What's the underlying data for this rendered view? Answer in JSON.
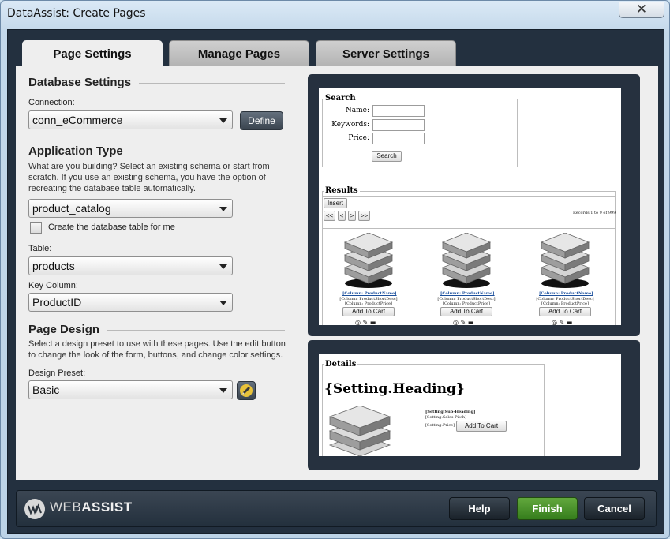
{
  "window": {
    "title": "DataAssist: Create Pages",
    "close_glyph": "✕"
  },
  "tabs": [
    {
      "label": "Page Settings",
      "active": true
    },
    {
      "label": "Manage Pages",
      "active": false
    },
    {
      "label": "Server Settings",
      "active": false
    }
  ],
  "database_settings": {
    "heading": "Database Settings",
    "connection_label": "Connection:",
    "connection_value": "conn_eCommerce",
    "define_label": "Define"
  },
  "application_type": {
    "heading": "Application Type",
    "description_1": "What are you building? Select an existing schema or start from",
    "description_2": "scratch. If you use an existing schema, you have the option of",
    "description_3": "recreating the database table automatically.",
    "schema_value": "product_catalog",
    "create_table_label": "Create the database table for me",
    "create_table_checked": false,
    "table_label": "Table:",
    "table_value": "products",
    "key_column_label": "Key Column:",
    "key_column_value": "ProductID"
  },
  "page_design": {
    "heading": "Page Design",
    "description_1": "Select a design preset to use with these pages. Use the edit button",
    "description_2": "to change the look of the form, buttons, and change color settings.",
    "preset_label": "Design Preset:",
    "preset_value": "Basic"
  },
  "preview_search": {
    "legend": "Search",
    "fields": [
      "Name:",
      "Keywords:",
      "Price:"
    ],
    "search_button": "Search",
    "results_legend": "Results",
    "insert_button": "Insert",
    "pager": [
      "<<",
      "<",
      ">",
      ">>"
    ],
    "records_text": "Records 1 to 9 of 999",
    "product_name": "[Column: ProductName]",
    "product_desc": "[Column: ProductShortDesc]",
    "product_price": "[Column: ProductPrice]",
    "add_to_cart": "Add To Cart"
  },
  "preview_details": {
    "legend": "Details",
    "heading": "{Setting.Heading}",
    "sub_heading": "[Setting.Sub-Heading]",
    "sales_pitch": "[Setting.Sales Pitch]",
    "price": "[Setting.Price]",
    "add_to_cart": "Add To Cart"
  },
  "footer": {
    "brand_light": "WEB",
    "brand_bold": "ASSIST",
    "help_label": "Help",
    "finish_label": "Finish",
    "cancel_label": "Cancel"
  },
  "colors": {
    "accent_green": "#4a9a2c",
    "frame_dark": "#23303f",
    "link_blue": "#1b4f9c"
  }
}
